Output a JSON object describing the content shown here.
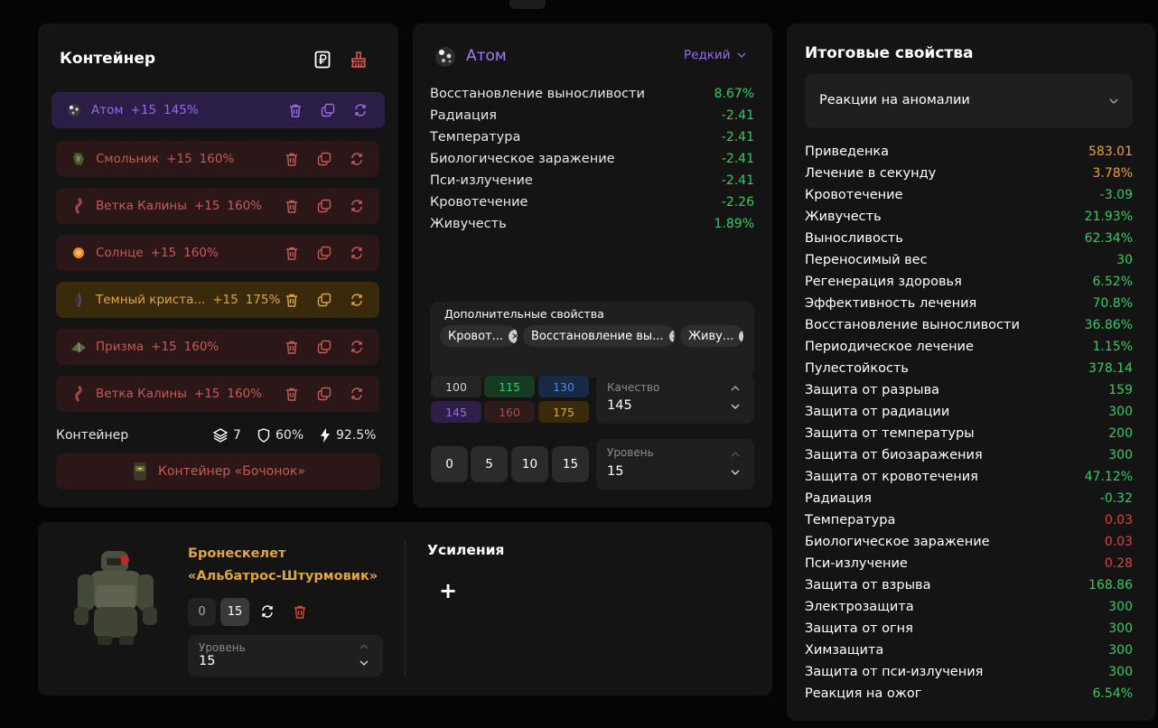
{
  "container": {
    "title": "Контейнер",
    "items": [
      {
        "name": "Атом",
        "level": "+15",
        "pct": "145%"
      },
      {
        "name": "Смольник",
        "level": "+15",
        "pct": "160%"
      },
      {
        "name": "Ветка Калины",
        "level": "+15",
        "pct": "160%"
      },
      {
        "name": "Солнце",
        "level": "+15",
        "pct": "160%"
      },
      {
        "name": "Темный криста...",
        "level": "+15",
        "pct": "175%"
      },
      {
        "name": "Призма",
        "level": "+15",
        "pct": "160%"
      },
      {
        "name": "Ветка Калины",
        "level": "+15",
        "pct": "160%"
      }
    ],
    "footer_label": "Контейнер",
    "slots": "7",
    "protection": "60%",
    "efficiency": "92.5%",
    "container_button": "Контейнер «Бочонок»"
  },
  "artifact": {
    "name": "Атом",
    "rarity": "Редкий",
    "stats": [
      {
        "name": "Восстановление выносливости",
        "value": "8.67%"
      },
      {
        "name": "Радиация",
        "value": "-2.41"
      },
      {
        "name": "Температура",
        "value": "-2.41"
      },
      {
        "name": "Биологическое заражение",
        "value": "-2.41"
      },
      {
        "name": "Пси-излучение",
        "value": "-2.41"
      },
      {
        "name": "Кровотечение",
        "value": "-2.26"
      },
      {
        "name": "Живучесть",
        "value": "1.89%"
      }
    ],
    "extra_title": "Дополнительные свойства",
    "extra_chips": [
      "Кровот...",
      "Восстановление вы...",
      "Живу..."
    ],
    "quality_buttons": [
      "100",
      "115",
      "130",
      "145",
      "160",
      "175"
    ],
    "quality_label": "Качество",
    "quality_value": "145",
    "level_buttons": [
      "0",
      "5",
      "10",
      "15"
    ],
    "level_label": "Уровень",
    "level_value": "15"
  },
  "armor": {
    "name_line1": "Бронескелет",
    "name_line2": "«Альбатрос-Штурмовик»",
    "upgrade_min": "0",
    "upgrade_max": "15",
    "level_label": "Уровень",
    "level_value": "15",
    "boosts_title": "Усиления",
    "add_label": "+"
  },
  "totals": {
    "title": "Итоговые свойства",
    "filter": "Реакции на аномалии",
    "rows": [
      {
        "name": "Приведенка",
        "value": "583.01",
        "color": "orange"
      },
      {
        "name": "Лечение в секунду",
        "value": "3.78%",
        "color": "orange"
      },
      {
        "name": "Кровотечение",
        "value": "-3.09",
        "color": "green"
      },
      {
        "name": "Живучесть",
        "value": "21.93%",
        "color": "green"
      },
      {
        "name": "Выносливость",
        "value": "62.34%",
        "color": "green"
      },
      {
        "name": "Переносимый вес",
        "value": "30",
        "color": "green"
      },
      {
        "name": "Регенерация здоровья",
        "value": "6.52%",
        "color": "green"
      },
      {
        "name": "Эффективность лечения",
        "value": "70.8%",
        "color": "green"
      },
      {
        "name": "Восстановление выносливости",
        "value": "36.86%",
        "color": "green"
      },
      {
        "name": "Периодическое лечение",
        "value": "1.15%",
        "color": "green"
      },
      {
        "name": "Пулестойкость",
        "value": "378.14",
        "color": "green"
      },
      {
        "name": "Защита от разрыва",
        "value": "159",
        "color": "green"
      },
      {
        "name": "Защита от радиации",
        "value": "300",
        "color": "green"
      },
      {
        "name": "Защита от температуры",
        "value": "200",
        "color": "green"
      },
      {
        "name": "Защита от биозаражения",
        "value": "300",
        "color": "green"
      },
      {
        "name": "Защита от кровотечения",
        "value": "47.12%",
        "color": "green"
      },
      {
        "name": "Радиация",
        "value": "-0.32",
        "color": "green"
      },
      {
        "name": "Температура",
        "value": "0.03",
        "color": "red"
      },
      {
        "name": "Биологическое заражение",
        "value": "0.03",
        "color": "red"
      },
      {
        "name": "Пси-излучение",
        "value": "0.28",
        "color": "red"
      },
      {
        "name": "Защита от взрыва",
        "value": "168.86",
        "color": "green"
      },
      {
        "name": "Электрозащита",
        "value": "300",
        "color": "green"
      },
      {
        "name": "Защита от огня",
        "value": "300",
        "color": "green"
      },
      {
        "name": "Химзащита",
        "value": "300",
        "color": "green"
      },
      {
        "name": "Защита от пси-излучения",
        "value": "300",
        "color": "green"
      },
      {
        "name": "Реакция на ожог",
        "value": "6.54%",
        "color": "green"
      }
    ]
  },
  "colors": {
    "green": "#2fce60",
    "orange": "#f0a233",
    "red": "#e0443c",
    "purple": "#9b6ae6",
    "gold": "#e2a43d",
    "rose": "#c65a55"
  }
}
